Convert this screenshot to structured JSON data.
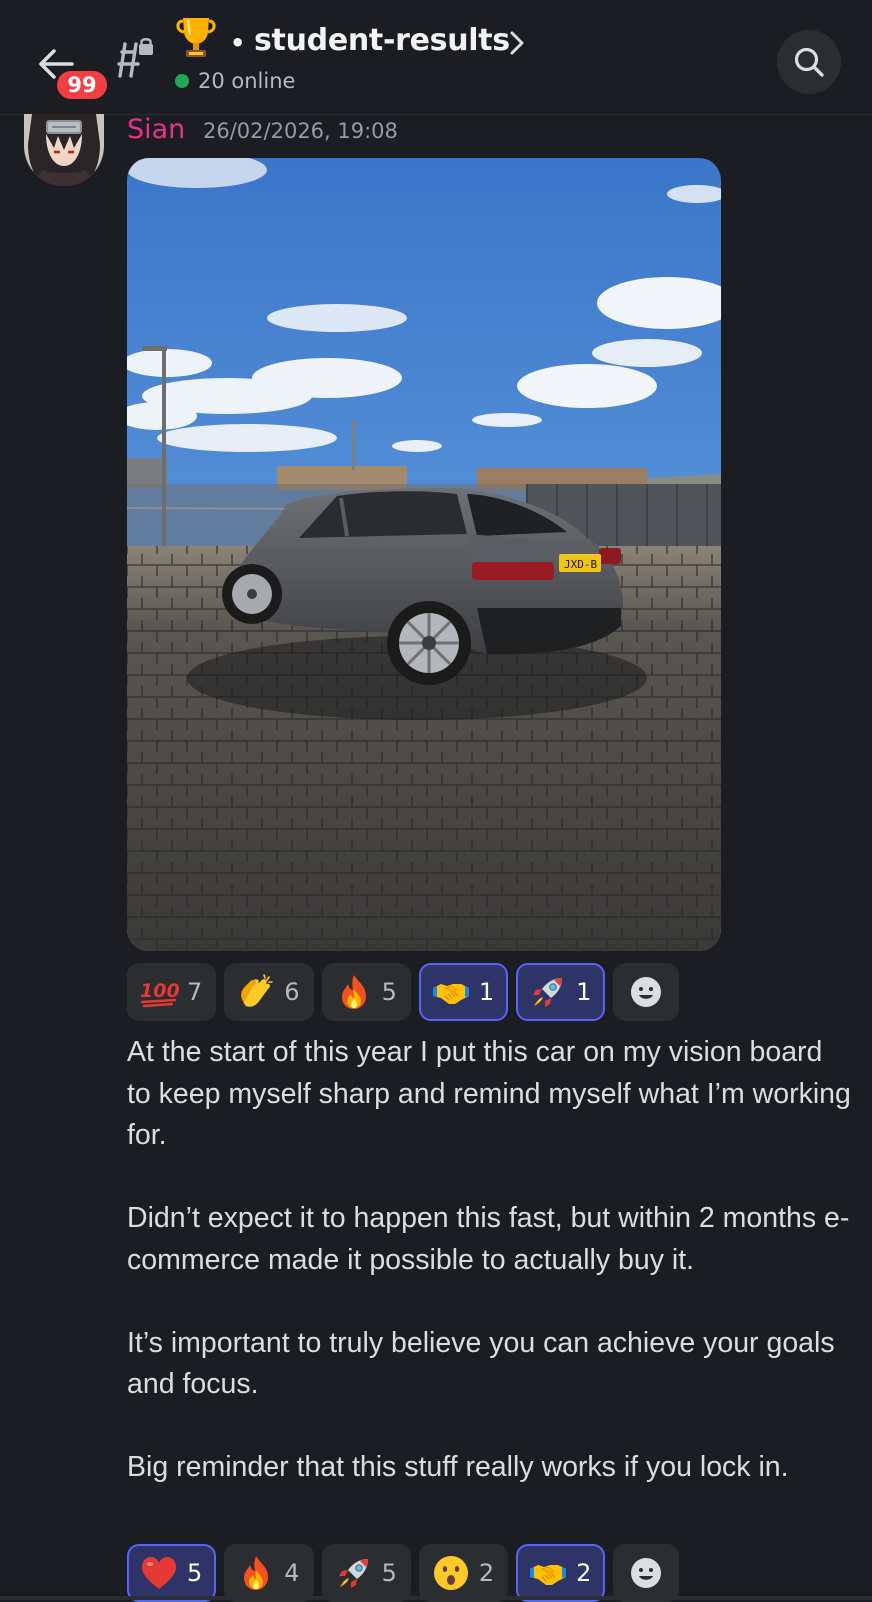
{
  "header": {
    "badge_count": "99",
    "channel_emoji": "trophy",
    "channel_separator": "•",
    "channel_name": "student-results",
    "online_text": "20 online",
    "icons": {
      "back": "arrow-left-icon",
      "channel": "locked-text-channel-icon",
      "chevron": "chevron-right-icon",
      "search": "search-icon"
    }
  },
  "message": {
    "username": "Sian",
    "username_color": "#e8328a",
    "timestamp": "26/02/2026, 19:08",
    "image_alt": "Photo of a grey SUV coupe parked on a brick-paved lot under a blue sky with clouds",
    "reactions": [
      {
        "emoji": "hundred-points",
        "count": "7",
        "selected": false
      },
      {
        "emoji": "clapping-hands",
        "count": "6",
        "selected": false
      },
      {
        "emoji": "fire",
        "count": "5",
        "selected": false
      },
      {
        "emoji": "handshake",
        "count": "1",
        "selected": true
      },
      {
        "emoji": "rocket",
        "count": "1",
        "selected": true
      }
    ],
    "paragraphs": [
      "At the start of this year I put this car on my vision board to keep myself sharp and remind myself what I’m working for.",
      "Didn’t expect it to happen this fast, but within 2 months e-commerce made it possible to actually buy it.",
      "It’s important to truly believe you can achieve your goals and focus.",
      "Big reminder that this stuff really works if you lock in."
    ],
    "reactions_bottom": [
      {
        "emoji": "red-heart",
        "count": "5",
        "selected": true
      },
      {
        "emoji": "fire",
        "count": "4",
        "selected": false
      },
      {
        "emoji": "rocket",
        "count": "5",
        "selected": false
      },
      {
        "emoji": "face-with-open-mouth",
        "count": "2",
        "selected": false
      },
      {
        "emoji": "handshake",
        "count": "2",
        "selected": true
      }
    ]
  },
  "colors": {
    "background": "#1c1d23",
    "accent": "#5865f2",
    "online": "#23a55a",
    "badge": "#f23f43"
  }
}
